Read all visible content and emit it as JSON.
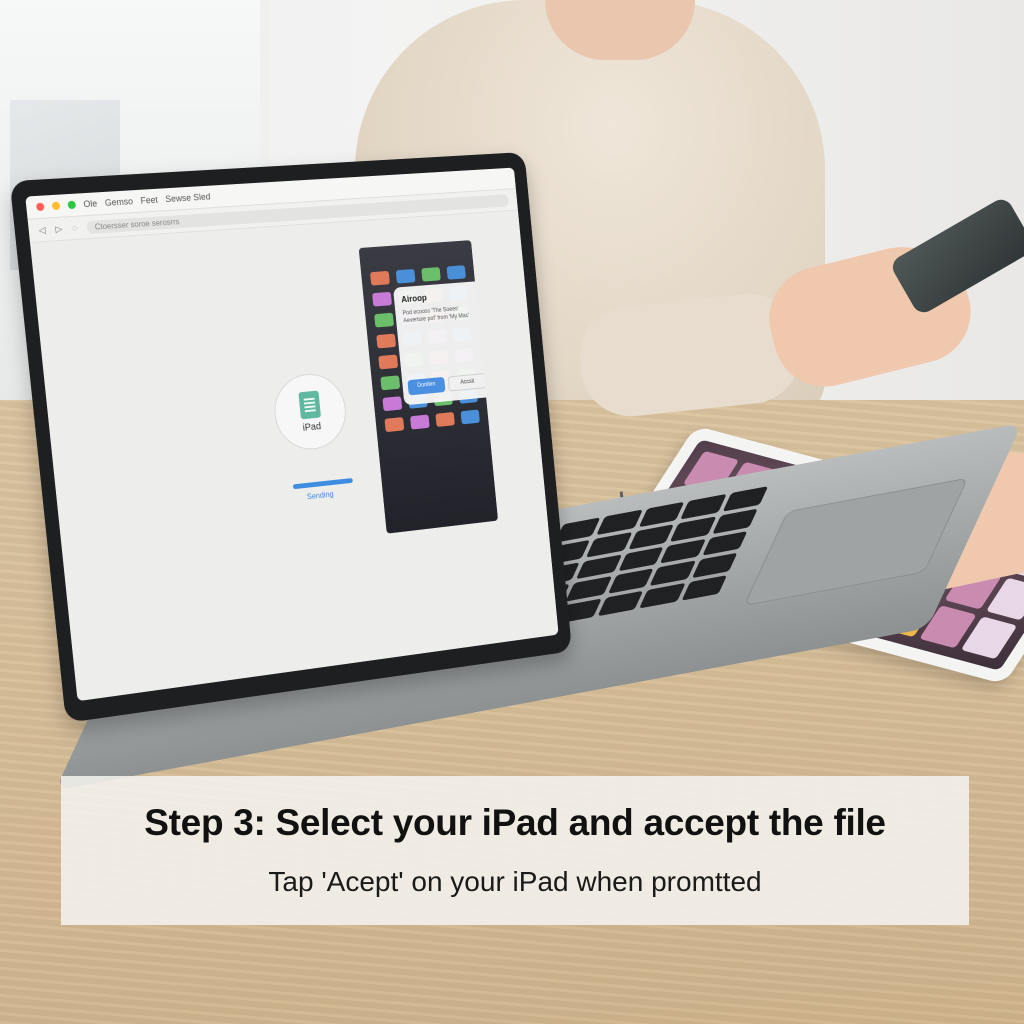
{
  "laptop": {
    "menu_items": [
      "Ole",
      "Gemso",
      "Feet",
      "Sewse Sled"
    ],
    "address_text": "Ctoersser soroe serosrrs",
    "toolbar_glyphs": [
      "◁",
      "▷",
      "◌"
    ],
    "device_label": "iPad",
    "status_text": "Sending",
    "progress": 1.0
  },
  "airdrop_alert": {
    "title": "Airoop",
    "message": "Pod ecooss 'The Soees' Aeverture pof' from 'My Mac'",
    "decline_label": "Dontlen",
    "accept_label": "Accsit"
  },
  "caption": {
    "title": "Step 3: Select your iPad and accept the file",
    "subtitle": "Tap 'Acept' on your iPad when promtted"
  },
  "colors": {
    "accent": "#3f8de0",
    "caption_background": "#f5f3f0",
    "file_icon": "#5fb8a0"
  },
  "icons": [
    "file-spreadsheet-icon",
    "close-dot-icon",
    "minimize-dot-icon",
    "zoom-dot-icon"
  ]
}
